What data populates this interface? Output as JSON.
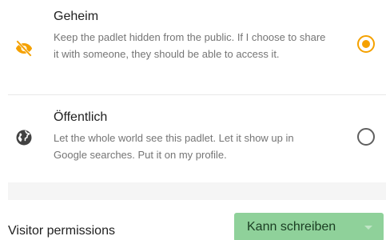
{
  "privacy_options": [
    {
      "title": "Geheim",
      "description": "Keep the padlet hidden from the public. If I choose to share it with someone, they should be able to access it.",
      "icon": "eye-off-icon",
      "icon_color": "#f5a100",
      "selected": true
    },
    {
      "title": "Öffentlich",
      "description": "Let the whole world see this padlet. Let it show up in Google searches. Put it on my profile.",
      "icon": "globe-icon",
      "icon_color": "#424242",
      "selected": false
    }
  ],
  "visitor_permissions": {
    "label": "Visitor permissions",
    "selected_value": "Kann schreiben",
    "button_color": "#8fd19a"
  }
}
